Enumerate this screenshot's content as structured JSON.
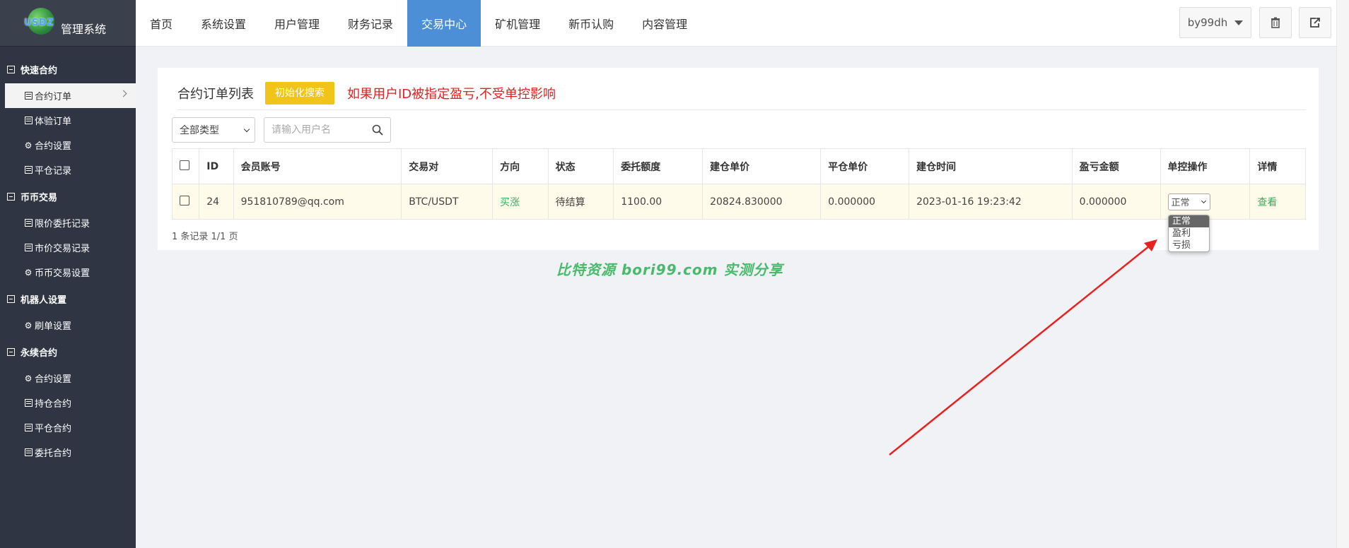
{
  "app": {
    "logo_text": "USDZ",
    "title": "管理系统"
  },
  "sidebar": {
    "groups": [
      {
        "title": "快速合约",
        "items": [
          {
            "label": "合约订单",
            "icon": "list-icon"
          },
          {
            "label": "体验订单",
            "icon": "list-icon"
          },
          {
            "label": "合约设置",
            "icon": "gear-icon"
          },
          {
            "label": "平仓记录",
            "icon": "list-icon"
          }
        ]
      },
      {
        "title": "币币交易",
        "items": [
          {
            "label": "限价委托记录",
            "icon": "list-icon"
          },
          {
            "label": "市价交易记录",
            "icon": "list-icon"
          },
          {
            "label": "币币交易设置",
            "icon": "gear-icon"
          }
        ]
      },
      {
        "title": "机器人设置",
        "items": [
          {
            "label": "刷单设置",
            "icon": "gear-icon"
          }
        ]
      },
      {
        "title": "永续合约",
        "items": [
          {
            "label": "合约设置",
            "icon": "gear-icon"
          },
          {
            "label": "持仓合约",
            "icon": "list-icon"
          },
          {
            "label": "平仓合约",
            "icon": "list-icon"
          },
          {
            "label": "委托合约",
            "icon": "list-icon"
          }
        ]
      }
    ]
  },
  "nav": {
    "items": [
      "首页",
      "系统设置",
      "用户管理",
      "财务记录",
      "交易中心",
      "矿机管理",
      "新币认购",
      "内容管理"
    ],
    "active": "交易中心"
  },
  "user": {
    "name": "by99dh"
  },
  "panel": {
    "title": "合约订单列表",
    "init_button": "初始化搜索",
    "warning": "如果用户ID被指定盈亏,不受单控影响",
    "type_filter": "全部类型",
    "search_placeholder": "请输入用户名"
  },
  "table": {
    "headers": [
      "ID",
      "会员账号",
      "交易对",
      "方向",
      "状态",
      "委托额度",
      "建仓单价",
      "平仓单价",
      "建仓时间",
      "盈亏金额",
      "单控操作",
      "详情"
    ],
    "rows": [
      {
        "id": "24",
        "account": "951810789@qq.com",
        "pair": "BTC/USDT",
        "direction": "买涨",
        "status": "待结算",
        "amount": "1100.00",
        "open_price": "20824.830000",
        "close_price": "0.000000",
        "open_time": "2023-01-16 19:23:42",
        "pnl": "0.000000",
        "control": "正常",
        "detail": "查看"
      }
    ]
  },
  "records": "1 条记录 1/1 页",
  "control_options": [
    "正常",
    "盈利",
    "亏损"
  ],
  "watermark": "比特资源 bori99.com 实测分享",
  "colors": {
    "sidebar_bg": "#2f3542",
    "nav_active": "#4d8fd6",
    "init_button": "#f0c419",
    "warning": "#e52020",
    "buy_green": "#2db55d"
  }
}
